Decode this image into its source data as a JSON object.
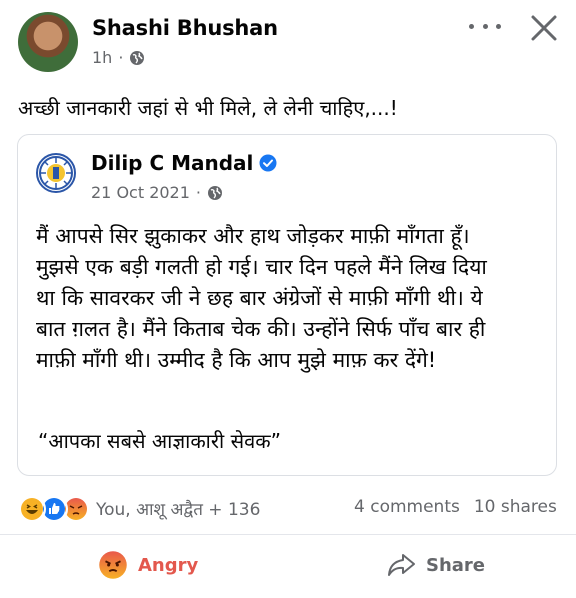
{
  "post": {
    "author": "Shashi Bhushan",
    "time": "1h",
    "separator": "·",
    "text": "अच्छी जानकारी जहां से भी मिले, ले लेनी चाहिए,...!"
  },
  "shared": {
    "author": "Dilip C Mandal",
    "date": "21 Oct 2021",
    "separator": "·",
    "body_lines": [
      "मैं आपसे सिर झुकाकर और हाथ जोड़कर माफ़ी माँगता हूँ।",
      "मुझसे एक बड़ी गलती हो गई। चार दिन पहले मैंने लिख दिया",
      "था कि सावरकर जी ने छह बार अंग्रेजों से माफ़ी माँगी थी। ये",
      "बात ग़लत है। मैंने किताब चेक की। उन्होंने सिर्फ पाँच बार ही",
      "माफ़ी माँगी थी। उम्मीद है कि आप मुझे माफ़ कर देंगे!"
    ],
    "signature": "“आपका सबसे आज्ञाकारी सेवक”"
  },
  "reactions": {
    "summary": "You, आशू अद्वैत + 136",
    "comments": "4 comments",
    "shares": "10 shares"
  },
  "actions": {
    "angry": "Angry",
    "share": "Share"
  },
  "colors": {
    "angry": "#e3584d",
    "like": "#1877f2",
    "haha": "#f7b125",
    "muted": "#65676b"
  }
}
